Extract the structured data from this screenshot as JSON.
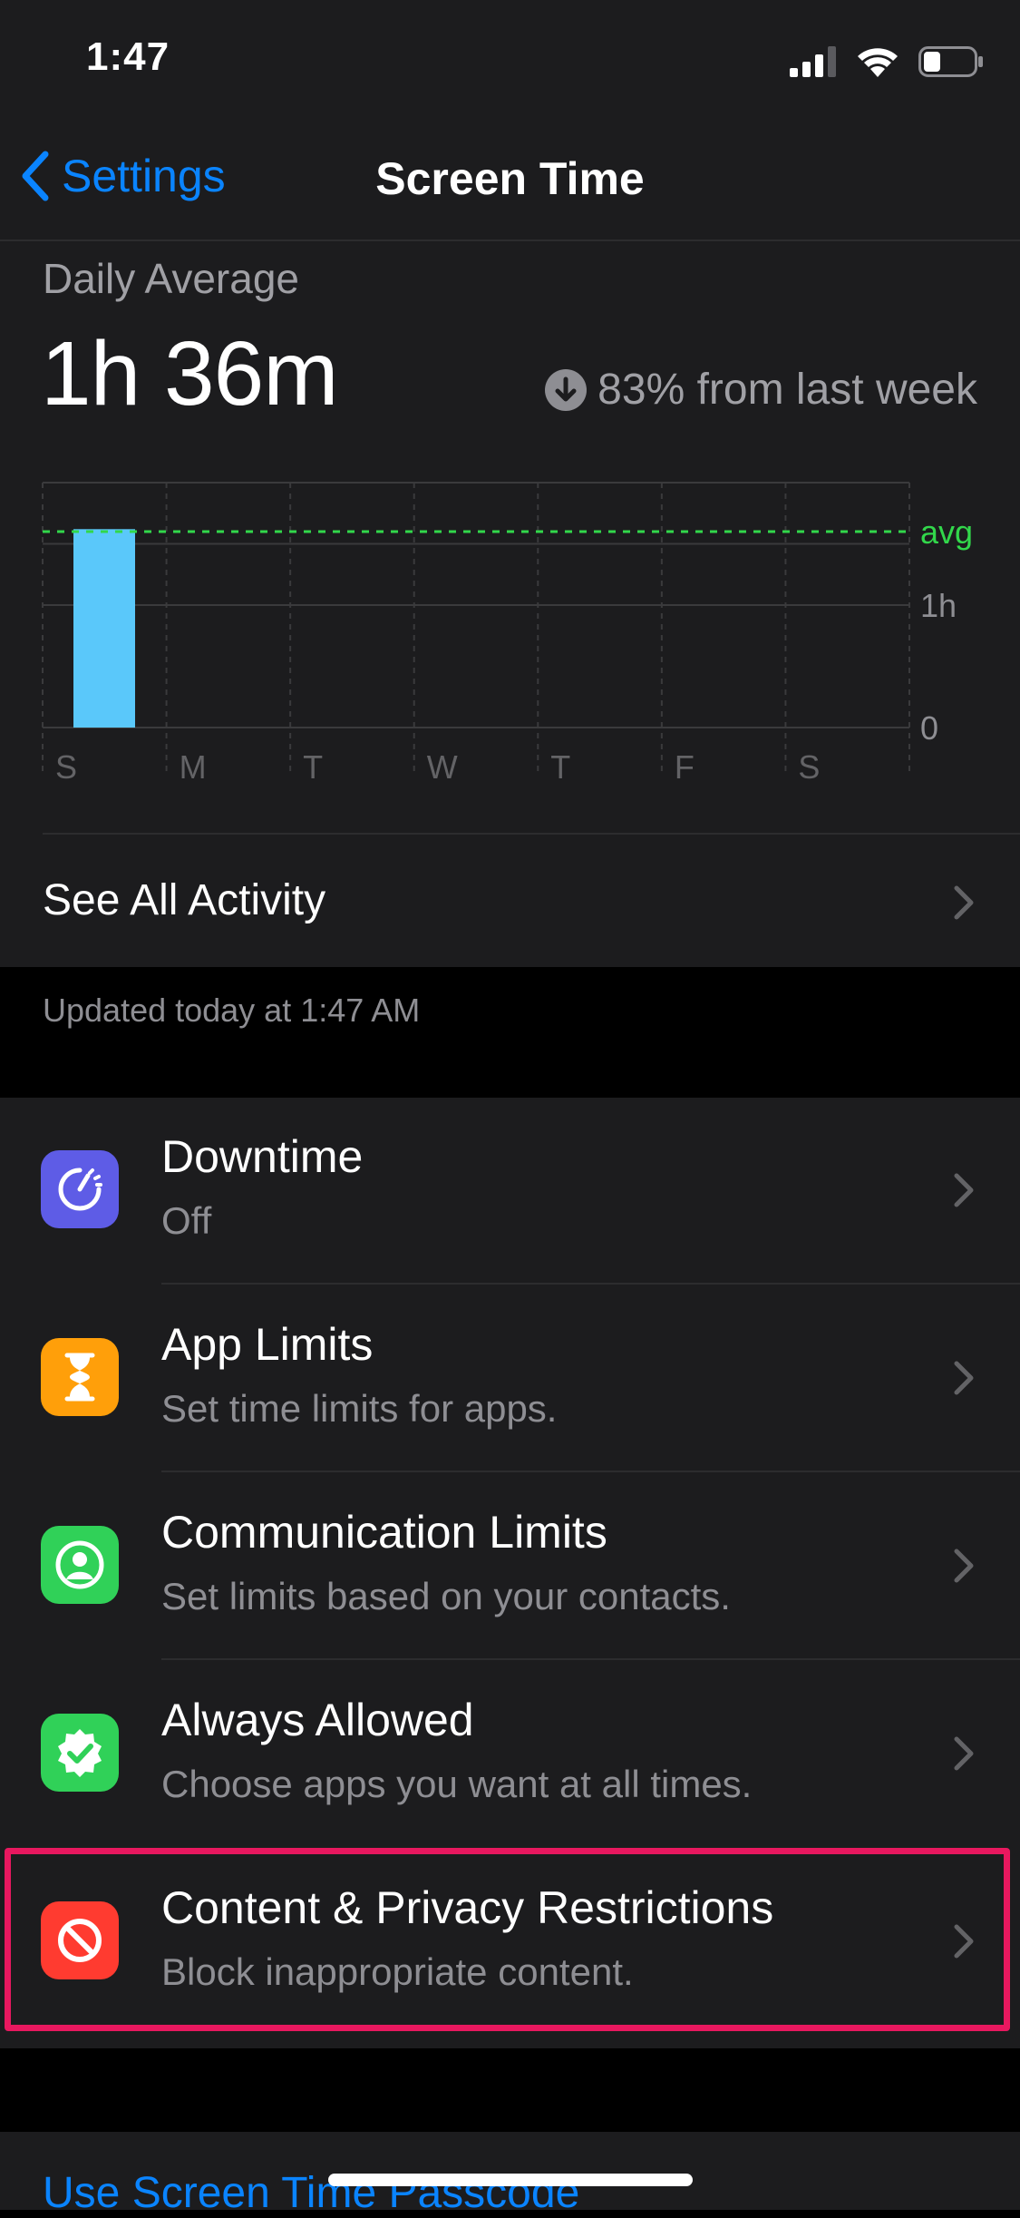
{
  "status_bar": {
    "time": "1:47"
  },
  "nav": {
    "back_label": "Settings",
    "title": "Screen Time"
  },
  "summary": {
    "daily_average_label": "Daily Average",
    "daily_average_value": "1h 36m",
    "change_text": "83% from last week",
    "change_direction": "down"
  },
  "chart_data": {
    "type": "bar",
    "categories": [
      "S",
      "M",
      "T",
      "W",
      "T",
      "F",
      "S"
    ],
    "values": [
      1.62,
      0,
      0,
      0,
      0,
      0,
      0
    ],
    "y_tick_labels": [
      "1h",
      "0"
    ],
    "avg_label": "avg",
    "average": 1.6,
    "ylim": [
      0,
      2
    ],
    "bar_color": "#5ac8fa",
    "avg_line_color": "#32d74b"
  },
  "activity": {
    "see_all_label": "See All Activity",
    "updated_text": "Updated today at 1:47 AM"
  },
  "settings_rows": [
    {
      "title": "Downtime",
      "subtitle": "Off",
      "icon": "downtime-icon",
      "color": "#5e5ce6"
    },
    {
      "title": "App Limits",
      "subtitle": "Set time limits for apps.",
      "icon": "hourglass-icon",
      "color": "#ff9f0a"
    },
    {
      "title": "Communication Limits",
      "subtitle": "Set limits based on your contacts.",
      "icon": "person-circle-icon",
      "color": "#30d158"
    },
    {
      "title": "Always Allowed",
      "subtitle": "Choose apps you want at all times.",
      "icon": "checkmark-seal-icon",
      "color": "#30d158"
    },
    {
      "title": "Content & Privacy Restrictions",
      "subtitle": "Block inappropriate content.",
      "icon": "restricted-icon",
      "color": "#ff3b30"
    }
  ],
  "passcode": {
    "label": "Use Screen Time Passcode"
  },
  "accent_color": "#0a84ff"
}
